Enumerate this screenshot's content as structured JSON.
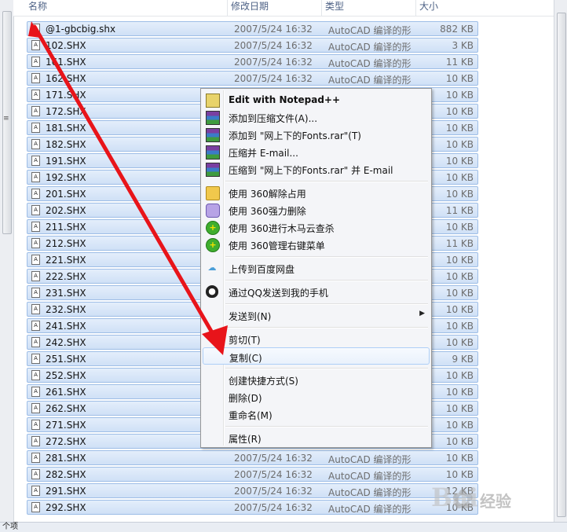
{
  "columns": {
    "name": "名称",
    "date": "修改日期",
    "type": "类型",
    "size": "大小"
  },
  "files": [
    {
      "name": "@1-gbcbig.shx",
      "date": "2007/5/24 16:32",
      "type": "AutoCAD 编译的形",
      "size": "882 KB"
    },
    {
      "name": "102.SHX",
      "date": "2007/5/24 16:32",
      "type": "AutoCAD 编译的形",
      "size": "3 KB"
    },
    {
      "name": "161.SHX",
      "date": "2007/5/24 16:32",
      "type": "AutoCAD 编译的形",
      "size": "11 KB"
    },
    {
      "name": "162.SHX",
      "date": "2007/5/24 16:32",
      "type": "AutoCAD 编译的形",
      "size": "10 KB"
    },
    {
      "name": "171.SHX",
      "date": "",
      "type": "",
      "size": "10 KB"
    },
    {
      "name": "172.SHX",
      "date": "",
      "type": "",
      "size": "10 KB"
    },
    {
      "name": "181.SHX",
      "date": "",
      "type": "",
      "size": "10 KB"
    },
    {
      "name": "182.SHX",
      "date": "",
      "type": "",
      "size": "10 KB"
    },
    {
      "name": "191.SHX",
      "date": "",
      "type": "",
      "size": "10 KB"
    },
    {
      "name": "192.SHX",
      "date": "",
      "type": "",
      "size": "10 KB"
    },
    {
      "name": "201.SHX",
      "date": "",
      "type": "",
      "size": "10 KB"
    },
    {
      "name": "202.SHX",
      "date": "",
      "type": "",
      "size": "11 KB"
    },
    {
      "name": "211.SHX",
      "date": "",
      "type": "",
      "size": "10 KB"
    },
    {
      "name": "212.SHX",
      "date": "",
      "type": "",
      "size": "11 KB"
    },
    {
      "name": "221.SHX",
      "date": "",
      "type": "",
      "size": "10 KB"
    },
    {
      "name": "222.SHX",
      "date": "",
      "type": "",
      "size": "10 KB"
    },
    {
      "name": "231.SHX",
      "date": "",
      "type": "",
      "size": "10 KB"
    },
    {
      "name": "232.SHX",
      "date": "",
      "type": "",
      "size": "10 KB"
    },
    {
      "name": "241.SHX",
      "date": "",
      "type": "",
      "size": "10 KB"
    },
    {
      "name": "242.SHX",
      "date": "",
      "type": "",
      "size": "10 KB"
    },
    {
      "name": "251.SHX",
      "date": "",
      "type": "",
      "size": "9 KB"
    },
    {
      "name": "252.SHX",
      "date": "",
      "type": "",
      "size": "10 KB"
    },
    {
      "name": "261.SHX",
      "date": "",
      "type": "",
      "size": "10 KB"
    },
    {
      "name": "262.SHX",
      "date": "",
      "type": "",
      "size": "10 KB"
    },
    {
      "name": "271.SHX",
      "date": "",
      "type": "",
      "size": "10 KB"
    },
    {
      "name": "272.SHX",
      "date": "",
      "type": "",
      "size": "10 KB"
    },
    {
      "name": "281.SHX",
      "date": "2007/5/24 16:32",
      "type": "AutoCAD 编译的形",
      "size": "10 KB"
    },
    {
      "name": "282.SHX",
      "date": "2007/5/24 16:32",
      "type": "AutoCAD 编译的形",
      "size": "10 KB"
    },
    {
      "name": "291.SHX",
      "date": "2007/5/24 16:32",
      "type": "AutoCAD 编译的形",
      "size": "12 KB"
    },
    {
      "name": "292.SHX",
      "date": "2007/5/24 16:32",
      "type": "AutoCAD 编译的形",
      "size": "10 KB"
    }
  ],
  "file_icon": "shx-file-icon",
  "context_menu": {
    "items": [
      {
        "label": "Edit with Notepad++",
        "icon": "notepad-plus-icon",
        "bold": true
      },
      {
        "label": "添加到压缩文件(A)...",
        "icon": "winrar-icon"
      },
      {
        "label": "添加到 \"网上下的Fonts.rar\"(T)",
        "icon": "winrar-icon"
      },
      {
        "label": "压缩并 E-mail...",
        "icon": "winrar-icon"
      },
      {
        "label": "压缩到 \"网上下的Fonts.rar\" 并 E-mail",
        "icon": "winrar-icon"
      },
      {
        "label": "使用 360解除占用",
        "icon": "folder-unlock-icon"
      },
      {
        "label": "使用 360强力删除",
        "icon": "shred-icon"
      },
      {
        "label": "使用 360进行木马云查杀",
        "icon": "360-icon"
      },
      {
        "label": "使用 360管理右键菜单",
        "icon": "360-icon"
      },
      {
        "label": "上传到百度网盘",
        "icon": "baidu-cloud-icon"
      },
      {
        "label": "通过QQ发送到我的手机",
        "icon": "qq-icon"
      },
      {
        "label": "发送到(N)",
        "icon": "",
        "submenu": true
      },
      {
        "label": "剪切(T)",
        "icon": ""
      },
      {
        "label": "复制(C)",
        "icon": "",
        "highlighted": true
      },
      {
        "label": "创建快捷方式(S)",
        "icon": ""
      },
      {
        "label": "删除(D)",
        "icon": ""
      },
      {
        "label": "重命名(M)",
        "icon": ""
      },
      {
        "label": "属性(R)",
        "icon": ""
      }
    ]
  },
  "status_bar": {
    "text": "个项"
  },
  "watermark": {
    "text": "经验",
    "brand": "Bai"
  },
  "colors": {
    "selection_fill": "#cfe0f6",
    "selection_border": "#9dbde6",
    "annotation_arrow": "#e8141a",
    "header_text": "#4d6185"
  }
}
